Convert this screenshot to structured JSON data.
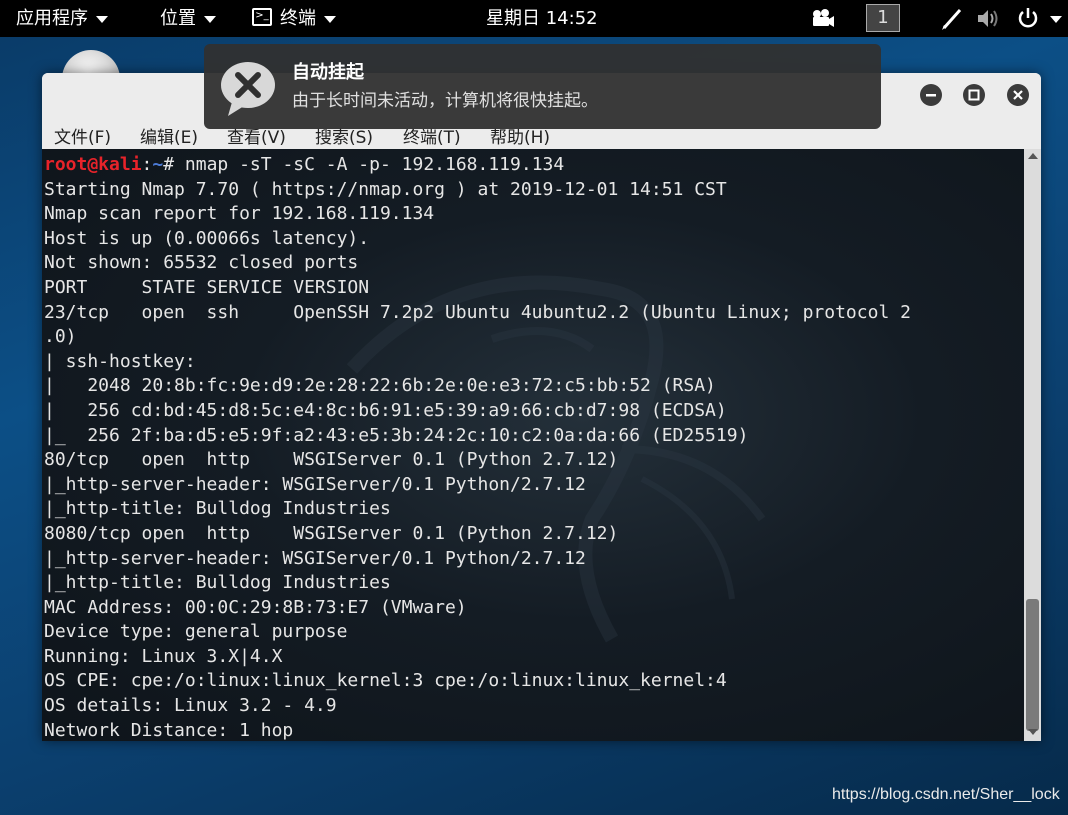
{
  "top_panel": {
    "applications": "应用程序",
    "places": "位置",
    "terminal_app": "终端",
    "clock": "星期日 14:52",
    "workspace": "1"
  },
  "notification": {
    "title": "自动挂起",
    "body": "由于长时间未活动，计算机将很快挂起。"
  },
  "window": {
    "menu": [
      "文件(F)",
      "编辑(E)",
      "查看(V)",
      "搜索(S)",
      "终端(T)",
      "帮助(H)"
    ]
  },
  "terminal": {
    "prompt_user": "root@kali",
    "prompt_sep": ":",
    "prompt_path": "~",
    "command": "# nmap -sT -sC -A -p- 192.168.119.134",
    "lines": [
      "Starting Nmap 7.70 ( https://nmap.org ) at 2019-12-01 14:51 CST",
      "Nmap scan report for 192.168.119.134",
      "Host is up (0.00066s latency).",
      "Not shown: 65532 closed ports",
      "PORT     STATE SERVICE VERSION",
      "23/tcp   open  ssh     OpenSSH 7.2p2 Ubuntu 4ubuntu2.2 (Ubuntu Linux; protocol 2",
      ".0)",
      "| ssh-hostkey: ",
      "|   2048 20:8b:fc:9e:d9:2e:28:22:6b:2e:0e:e3:72:c5:bb:52 (RSA)",
      "|   256 cd:bd:45:d8:5c:e4:8c:b6:91:e5:39:a9:66:cb:d7:98 (ECDSA)",
      "|_  256 2f:ba:d5:e5:9f:a2:43:e5:3b:24:2c:10:c2:0a:da:66 (ED25519)",
      "80/tcp   open  http    WSGIServer 0.1 (Python 2.7.12)",
      "|_http-server-header: WSGIServer/0.1 Python/2.7.12",
      "|_http-title: Bulldog Industries",
      "8080/tcp open  http    WSGIServer 0.1 (Python 2.7.12)",
      "|_http-server-header: WSGIServer/0.1 Python/2.7.12",
      "|_http-title: Bulldog Industries",
      "MAC Address: 00:0C:29:8B:73:E7 (VMware)",
      "Device type: general purpose",
      "Running: Linux 3.X|4.X",
      "OS CPE: cpe:/o:linux:linux_kernel:3 cpe:/o:linux:linux_kernel:4",
      "OS details: Linux 3.2 - 4.9",
      "Network Distance: 1 hop"
    ]
  },
  "watermark": "https://blog.csdn.net/Sher__lock"
}
